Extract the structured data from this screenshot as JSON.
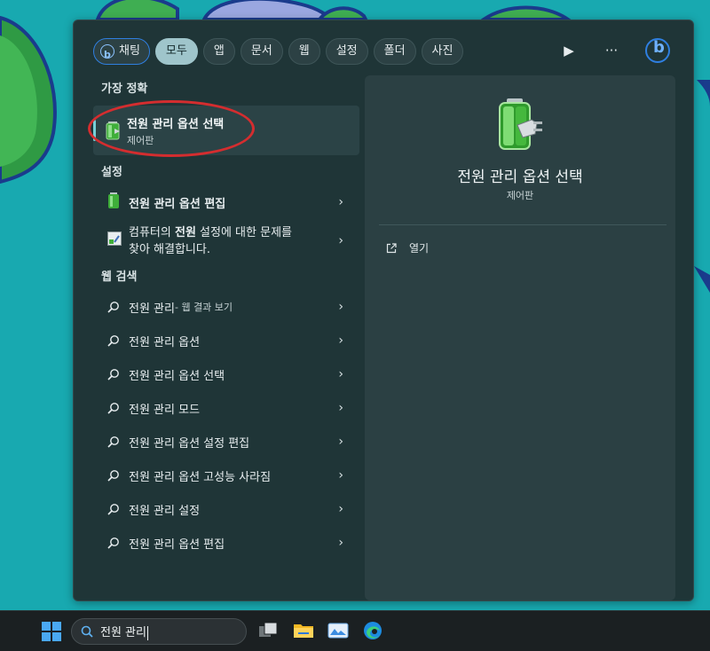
{
  "search_panel": {
    "filters": [
      {
        "label": "채팅",
        "icon": "bing-chat-icon"
      },
      {
        "label": "모두",
        "active": true
      },
      {
        "label": "앱"
      },
      {
        "label": "문서"
      },
      {
        "label": "웹"
      },
      {
        "label": "설정"
      },
      {
        "label": "폴더"
      },
      {
        "label": "사진"
      }
    ],
    "tools": {
      "play_icon": "play-icon",
      "more_icon": "more-icon",
      "bing_icon": "bing-icon"
    },
    "best_match": {
      "heading": "가장 정확",
      "title": "전원 관리 옵션 선택",
      "subtitle": "제어판"
    },
    "settings": {
      "heading": "설정",
      "items": [
        {
          "label": "전원 관리 옵션 편집"
        },
        {
          "line1_pre": "컴퓨터의 ",
          "line1_bold": "전원",
          "line1_post": " 설정에 대한 문제를",
          "line2": "찾아 해결합니다."
        }
      ]
    },
    "web_search": {
      "heading": "웹 검색",
      "first": {
        "query": "전원 관리",
        "suffix": " - 웹 결과 보기"
      },
      "items": [
        {
          "query": "전원 관리 옵션"
        },
        {
          "query": "전원 관리 옵션 선택"
        },
        {
          "query": "전원 관리 모드"
        },
        {
          "query": "전원 관리 옵션 설정 편집"
        },
        {
          "query": "전원 관리 옵션 고성능 사라짐"
        },
        {
          "query": "전원 관리 설정"
        },
        {
          "query": "전원 관리 옵션 편집"
        }
      ]
    },
    "preview": {
      "title": "전원 관리 옵션 선택",
      "type": "제어판",
      "open_label": "열기"
    }
  },
  "taskbar": {
    "search_value": "전원 관리",
    "apps": [
      "task-view-icon",
      "file-explorer-icon",
      "photos-icon",
      "edge-icon"
    ]
  },
  "colors": {
    "accent": "#76d0d8",
    "highlight_ring": "#d42d2f",
    "wallpaper": "#18a9b0"
  }
}
